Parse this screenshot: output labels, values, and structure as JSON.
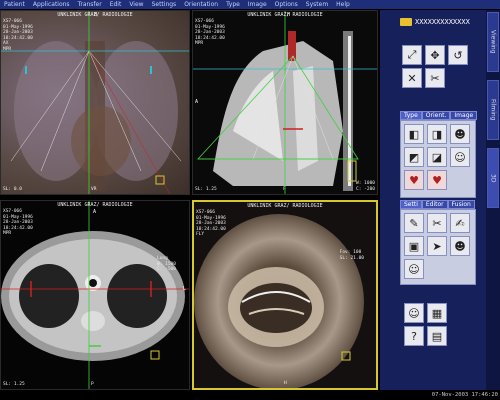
{
  "menu": [
    "Patient",
    "Applications",
    "Transfer",
    "Edit",
    "View",
    "Settings",
    "Orientation",
    "Type",
    "Image",
    "Options",
    "System",
    "Help"
  ],
  "viewports": {
    "top_left": {
      "header": "UNKLINIK GRAZ/ RADIOLOGIE",
      "info": "XS7-066\n01-May-1996\n28-Jan-2003\n18:24:42.00\nAX\nMPR",
      "orient_top": "H",
      "bottom_right": "VR",
      "slice": "SL: 0.0"
    },
    "top_right": {
      "header": "UNKLINIK GRAZ/ RADIOLOGIE",
      "info": "XS7-066\n01-May-1996\n28-Jan-2003\n18:24:42.00\nMPR",
      "orient_top": "H",
      "orient_left": "A",
      "orient_bottom": "F",
      "slice": "SL: 1.25",
      "wl": "W: 1000\nC: -200"
    },
    "bottom_left": {
      "header": "UNKLINIK GRAZ/ RADIOLOGIE",
      "info": "XS7-066\n01-May-1996\n28-Jan-2003\n18:24:42.00\nMPR",
      "orient_top": "A",
      "orient_right": "L",
      "orient_bottom": "P",
      "slice": "SL: 1.25",
      "side": "Lung\nW: 1500\nC: -500"
    },
    "bottom_right": {
      "header": "UNKLINIK GRAZ/ RADIOLOGIE",
      "info": "XS7-066\n01-May-1996\n28-Jan-2003\n18:24:42.00\nFLY",
      "side": "Fov: 100\nSL: 21.00",
      "orient_bottom": "H"
    }
  },
  "panel": {
    "folder_label": "XXXXXXXXXXXXX",
    "vertical_tabs": [
      "Viewing",
      "Filming",
      "3D"
    ],
    "group1_tabs": [
      "Type",
      "Orient.",
      "Image"
    ],
    "group2_tabs": [
      "Setti",
      "Editor",
      "Fusion"
    ]
  },
  "status": {
    "datetime": "07-Nov-2003 17:46:20"
  },
  "colors": {
    "menubar": "#1e2e78",
    "panel": "#16205a",
    "active_border": "#d8c830",
    "crosshair_green": "#40d040",
    "crosshair_cyan": "#30c0d0",
    "crosshair_red": "#d02020"
  }
}
